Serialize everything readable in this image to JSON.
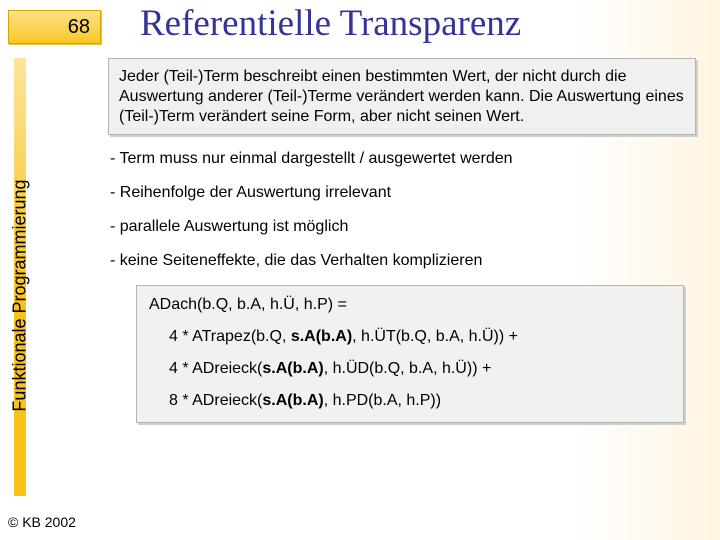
{
  "pageNumber": "68",
  "title": "Referentielle Transparenz",
  "sidebar": "Funktionale Programmierung",
  "definition": "Jeder (Teil-)Term beschreibt einen bestimmten Wert, der nicht durch die Auswertung anderer (Teil-)Terme verändert werden kann. Die Auswertung eines (Teil-)Term verändert seine Form, aber nicht seinen Wert.",
  "bullets": {
    "b1": "- Term muss nur einmal dargestellt / ausgewertet werden",
    "b2": "- Reihenfolge der Auswertung irrelevant",
    "b3": "- parallele Auswertung ist möglich",
    "b4": "- keine Seiteneffekte, die das Verhalten komplizieren"
  },
  "code": {
    "l1": "ADach(b.Q, b.A, h.Ü, h.P) =",
    "l2a": "4 * ATrapez(b.Q, ",
    "l2b": "s.A(b.A)",
    "l2c": ", h.ÜT(b.Q, b.A, h.Ü)) +",
    "l3a": "4 * ADreieck(",
    "l3b": "s.A(b.A)",
    "l3c": ", h.ÜD(b.Q, b.A, h.Ü)) +",
    "l4a": "8 * ADreieck(",
    "l4b": "s.A(b.A)",
    "l4c": ", h.PD(b.A, h.P))"
  },
  "copyright": "© KB 2002"
}
